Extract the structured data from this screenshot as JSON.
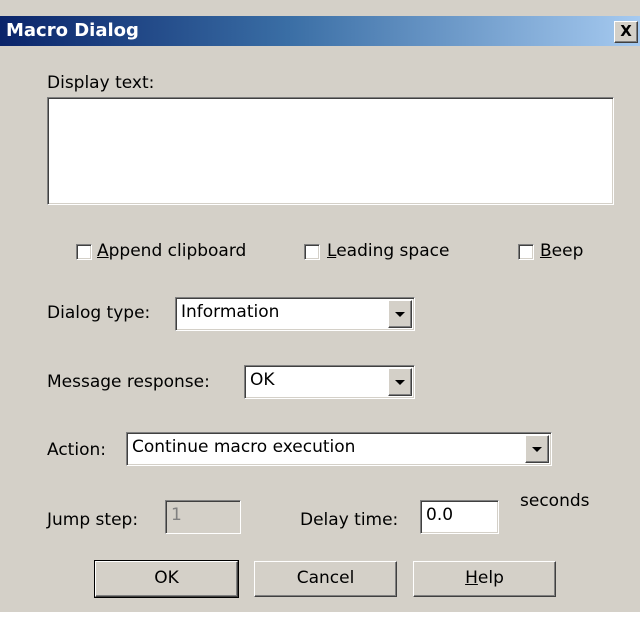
{
  "window": {
    "title": "Macro Dialog",
    "close_glyph": "X"
  },
  "display_text": {
    "label": "Display text:",
    "value": ""
  },
  "options": {
    "append_clipboard": {
      "mnemonic": "A",
      "rest": "ppend clipboard",
      "checked": false
    },
    "leading_space": {
      "mnemonic": "L",
      "rest": "eading space",
      "checked": false
    },
    "beep": {
      "mnemonic": "B",
      "rest": "eep",
      "checked": false
    }
  },
  "dialog_type": {
    "label": "Dialog type:",
    "value": "Information"
  },
  "message_response": {
    "label": "Message response:",
    "value": "OK"
  },
  "action": {
    "label": "Action:",
    "value": "Continue macro execution"
  },
  "jump_step": {
    "label": "Jump step:",
    "value": "1",
    "disabled": true
  },
  "delay_time": {
    "label": "Delay time:",
    "value": "0.0",
    "unit": "seconds"
  },
  "buttons": {
    "ok": "OK",
    "cancel": "Cancel",
    "help_mnemonic": "H",
    "help_rest": "elp"
  },
  "icons": {
    "dropdown": "chevron-down-icon",
    "close": "close-icon"
  }
}
